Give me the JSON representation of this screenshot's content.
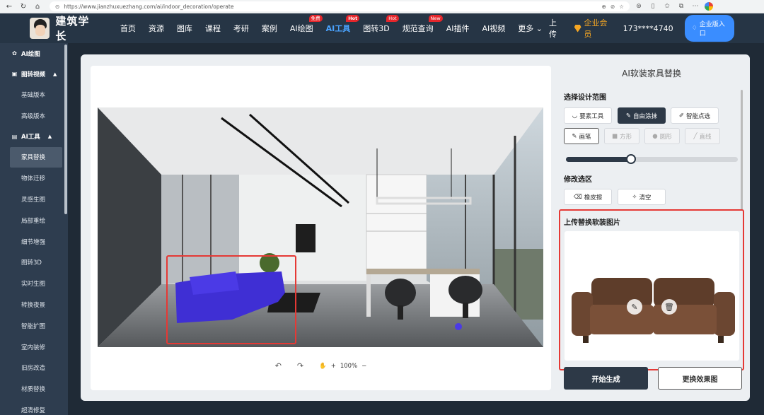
{
  "browser": {
    "url": "https://www.jianzhuxuezhang.com/ai/indoor_decoration/operate"
  },
  "header": {
    "site_name": "建筑学长",
    "nav": [
      {
        "label": "首页"
      },
      {
        "label": "资源"
      },
      {
        "label": "图库"
      },
      {
        "label": "课程"
      },
      {
        "label": "考研"
      },
      {
        "label": "案例"
      },
      {
        "label": "AI绘图",
        "badge": "免费"
      },
      {
        "label": "AI工具",
        "badge": "Hot",
        "active": true
      },
      {
        "label": "图转3D",
        "badge": "Hot"
      },
      {
        "label": "规范查询",
        "badge": "New"
      },
      {
        "label": "AI插件"
      },
      {
        "label": "AI视频"
      },
      {
        "label": "更多"
      }
    ],
    "upload": "上传",
    "vip": "企业会员",
    "phone": "173****4740",
    "enterprise_btn": "企业版入口"
  },
  "sidebar": {
    "sec_ai_draw": "AI绘图",
    "sec_img_video": "图转视频",
    "img_video_items": [
      "基础版本",
      "高级版本"
    ],
    "sec_ai_tools": "AI工具",
    "ai_tool_items": [
      "家具替换",
      "物体迁移",
      "灵感生图",
      "局部重绘",
      "细节增强",
      "图转3D",
      "实时生图",
      "转换夜景",
      "智能扩图",
      "室内装修",
      "旧房改造",
      "材质替换",
      "超清修复"
    ]
  },
  "canvas": {
    "zoom": "100%"
  },
  "panel": {
    "title": "AI软装家具替换",
    "design_scope": "选择设计范围",
    "tool_elements": "要素工具",
    "tool_freehand": "自由涂抹",
    "tool_smart": "智能点选",
    "brush": "画笔",
    "rect": "方形",
    "circle": "圆形",
    "line": "直线",
    "brush_size": 0.38,
    "modify": "修改选区",
    "eraser": "橡皮擦",
    "clear": "清空",
    "upload_label": "上传替换软装图片",
    "generate": "开始生成",
    "change": "更换效果图"
  }
}
